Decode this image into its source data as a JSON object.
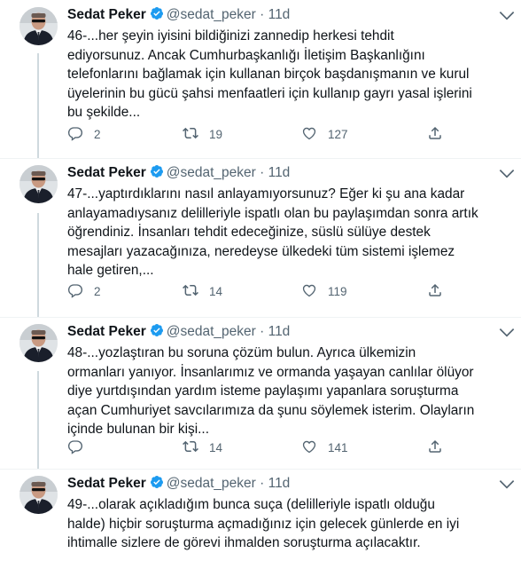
{
  "tweets": [
    {
      "name": "Sedat Peker",
      "handle": "@sedat_peker",
      "dot": "·",
      "time": "11d",
      "text": "46-...her şeyin iyisini bildiğinizi zannedip herkesi tehdit\nediyorsunuz. Ancak Cumhurbaşkanlığı İletişim Başkanlığını\ntelefonlarını bağlamak için kullanan birçok başdanışmanın ve kurul\nüyelerinin bu gücü şahsi menfaatleri için kullanıp gayrı yasal işlerini\nbu şekilde...",
      "replies": "2",
      "retweets": "19",
      "likes": "127"
    },
    {
      "name": "Sedat Peker",
      "handle": "@sedat_peker",
      "dot": "·",
      "time": "11d",
      "text": "47-...yaptırdıklarını nasıl anlayamıyorsunuz? Eğer ki şu ana kadar\nanlayamadıysanız delilleriyle ispatlı olan bu paylaşımdan sonra artık\nöğrendiniz. İnsanları tehdit edeceğinize, süslü sülüye destek\nmesajları yazacağınıza, neredeyse ülkedeki tüm sistemi işlemez\nhale getiren,...",
      "replies": "2",
      "retweets": "14",
      "likes": "119"
    },
    {
      "name": "Sedat Peker",
      "handle": "@sedat_peker",
      "dot": "·",
      "time": "11d",
      "text": "48-...yozlaştıran bu soruna çözüm bulun. Ayrıca ülkemizin\normanları yanıyor. İnsanlarımız ve ormanda yaşayan canlılar ölüyor\ndiye yurtdışından yardım isteme paylaşımı yapanlara soruşturma\naçan Cumhuriyet savcılarımıza da şunu söylemek isterim. Olayların\niçinde bulunan bir kişi...",
      "replies": "",
      "retweets": "14",
      "likes": "141"
    },
    {
      "name": "Sedat Peker",
      "handle": "@sedat_peker",
      "dot": "·",
      "time": "11d",
      "text": "49-...olarak açıkladığım bunca suça (delilleriyle ispatlı olduğu\nhalde) hiçbir soruşturma açmadığınız için gelecek günlerde en iyi\nihtimalle sizlere de görevi ihmalden soruşturma açılacaktır.",
      "replies": "",
      "retweets": "",
      "likes": ""
    }
  ],
  "icons": {
    "verified": "verified-badge-icon",
    "more": "more-options-icon",
    "reply": "reply-icon",
    "retweet": "retweet-icon",
    "like": "like-icon",
    "share": "share-icon"
  },
  "colors": {
    "verified": "#1d9bf0",
    "secondary_text": "#536471",
    "primary_text": "#0f1419",
    "thread_line": "#cfd9de"
  }
}
